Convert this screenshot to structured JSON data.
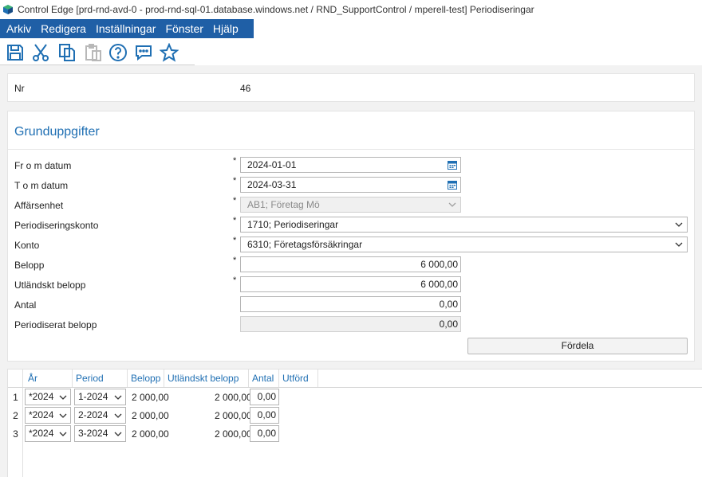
{
  "window": {
    "title": "Control Edge [prd-rnd-avd-0 - prod-rnd-sql-01.database.windows.net / RND_SupportControl / mperell-test] Periodiseringar"
  },
  "menu": [
    "Arkiv",
    "Redigera",
    "Inställningar",
    "Fönster",
    "Hjälp"
  ],
  "toolbar_icons": [
    "save-icon",
    "cut-icon",
    "copy-icon",
    "paste-icon",
    "help-icon",
    "comment-icon",
    "favorite-icon"
  ],
  "colors": {
    "menu_bg": "#1f5fa6",
    "accent": "#1f6fb3"
  },
  "header": {
    "nr_label": "Nr",
    "nr_value": "46"
  },
  "section": {
    "title": "Grunduppgifter"
  },
  "form": {
    "from_label": "Fr o m datum",
    "from_value": "2024-01-01",
    "tom_label": "T o m datum",
    "tom_value": "2024-03-31",
    "unit_label": "Affärsenhet",
    "unit_value": "AB1; Företag Mö",
    "accrual_label": "Periodiseringskonto",
    "accrual_value": "1710; Periodiseringar",
    "account_label": "Konto",
    "account_value": "6310; Företagsförsäkringar",
    "amount_label": "Belopp",
    "amount_value": "6 000,00",
    "foreign_label": "Utländskt belopp",
    "foreign_value": "6 000,00",
    "qty_label": "Antal",
    "qty_value": "0,00",
    "accrued_label": "Periodiserat belopp",
    "accrued_value": "0,00",
    "required_mark": "*"
  },
  "buttons": {
    "distribute": "Fördela"
  },
  "grid": {
    "columns": [
      "År",
      "Period",
      "Belopp",
      "Utländskt belopp",
      "Antal",
      "Utförd"
    ],
    "rows": [
      {
        "n": "1",
        "year": "*2024",
        "period": "1-2024",
        "amount": "2 000,00",
        "foreign": "2 000,00",
        "qty": "0,00"
      },
      {
        "n": "2",
        "year": "*2024",
        "period": "2-2024",
        "amount": "2 000,00",
        "foreign": "2 000,00",
        "qty": "0,00"
      },
      {
        "n": "3",
        "year": "*2024",
        "period": "3-2024",
        "amount": "2 000,00",
        "foreign": "2 000,00",
        "qty": "0,00"
      }
    ]
  }
}
